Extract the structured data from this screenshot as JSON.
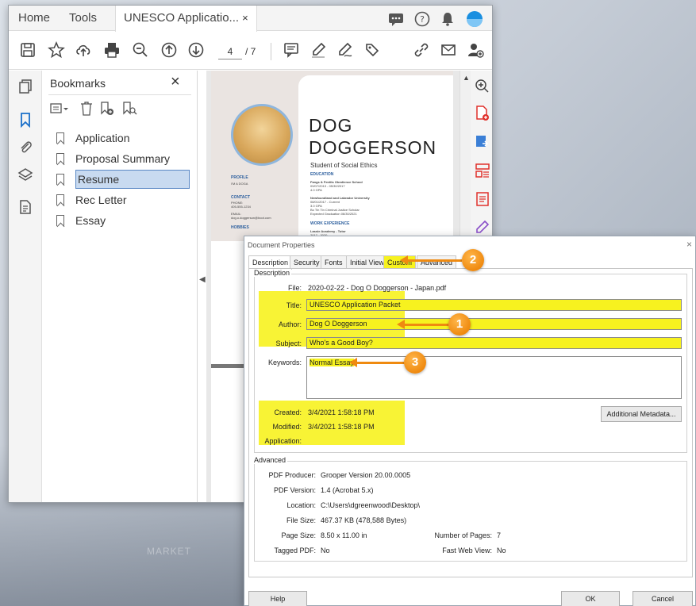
{
  "tabs": {
    "home": "Home",
    "tools": "Tools",
    "document": "UNESCO Applicatio...",
    "close": "×"
  },
  "toolbar": {
    "page_current": "4",
    "page_total": "/ 7"
  },
  "bookmarks": {
    "title": "Bookmarks",
    "close": "×",
    "items": [
      {
        "label": "Application"
      },
      {
        "label": "Proposal Summary"
      },
      {
        "label": "Resume"
      },
      {
        "label": "Rec Letter"
      },
      {
        "label": "Essay"
      }
    ]
  },
  "resume": {
    "name_line1": "DOG",
    "name_line2": "DOGGERSON",
    "subtitle": "Student of Social Ethics",
    "profile": "PROFILE",
    "profile_text": "I'M A DOGA",
    "contact": "CONTACT",
    "phone_label": "PHONE:",
    "phone": "405-555-1234",
    "email_label": "EMAIL:",
    "email": "dog.o.doggerson@boot.com",
    "hobbies": "HOBBIES",
    "education": "EDUCATION",
    "edu1_title": "Fangs & Fenlits Obedience School",
    "edu1_dates": "09/07/2013 - 05/30/2017",
    "edu1_gpa": "4.0 GPA",
    "edu2_title": "Newfoundland and Labrador University",
    "edu2_dates": "08/01/2017 - Current",
    "edu2_gpa": "3.0 GPA",
    "edu2_note": "Bo Tin Tin Criminal Justice Scholar",
    "edu2_grad": "Expected Graduation 06/30/2021",
    "work": "WORK EXPERIENCE",
    "work1": "Lassie Academy - Tutor",
    "work1_dates": "2017 - 2020"
  },
  "dialog": {
    "title": "Document Properties",
    "close": "×",
    "tabs": [
      "Description",
      "Security",
      "Fonts",
      "Initial View",
      "Custom",
      "Advanced"
    ],
    "description_group": "Description",
    "file_label": "File:",
    "file_value": "2020-02-22 - Dog O Doggerson - Japan.pdf",
    "title_label": "Title:",
    "title_value": "UNESCO Application Packet",
    "author_label": "Author:",
    "author_value": "Dog O Doggerson",
    "subject_label": "Subject:",
    "subject_value": "Who's a Good Boy?",
    "keywords_label": "Keywords:",
    "keywords_value": "Normal Essay",
    "created_label": "Created:",
    "created_value": "3/4/2021 1:58:18 PM",
    "modified_label": "Modified:",
    "modified_value": "3/4/2021 1:58:18 PM",
    "application_label": "Application:",
    "application_value": "",
    "additional_metadata": "Additional Metadata...",
    "advanced_group": "Advanced",
    "producer_label": "PDF Producer:",
    "producer_value": "Grooper Version 20.00.0005",
    "version_label": "PDF Version:",
    "version_value": "1.4 (Acrobat 5.x)",
    "location_label": "Location:",
    "location_value": "C:\\Users\\dgreenwood\\Desktop\\",
    "filesize_label": "File Size:",
    "filesize_value": "467.37 KB (478,588 Bytes)",
    "pagesize_label": "Page Size:",
    "pagesize_value": "8.50 x 11.00 in",
    "numpages_label": "Number of Pages:",
    "numpages_value": "7",
    "tagged_label": "Tagged PDF:",
    "tagged_value": "No",
    "fastweb_label": "Fast Web View:",
    "fastweb_value": "No",
    "help": "Help",
    "ok": "OK",
    "cancel": "Cancel"
  },
  "callouts": {
    "one": "1",
    "two": "2",
    "three": "3"
  },
  "background": {
    "market": "MARKET"
  },
  "colors": {
    "highlight": "#f7f21f",
    "callout": "#ef8a10",
    "selection": "#c8daf0",
    "avatar": "#1a8fe0"
  }
}
